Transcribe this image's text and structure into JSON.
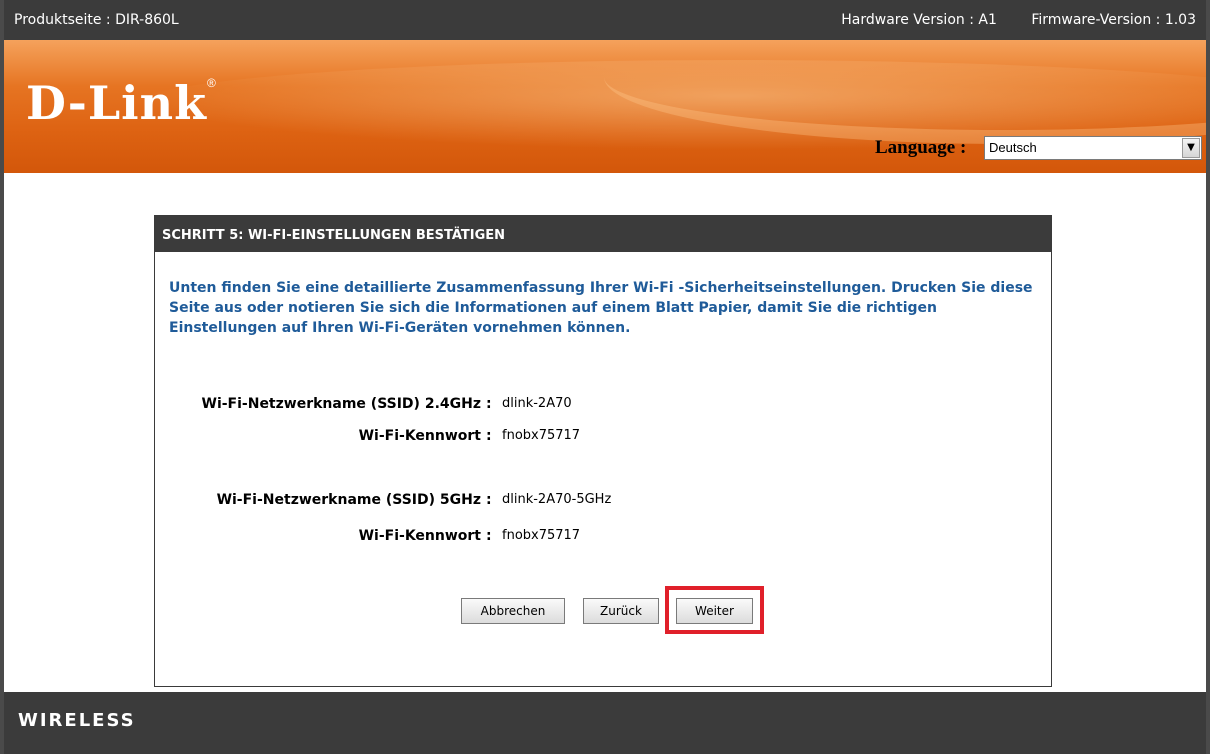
{
  "topbar": {
    "product": "Produktseite : DIR-860L",
    "hardware": "Hardware Version : A1",
    "firmware": "Firmware-Version : 1.03"
  },
  "header": {
    "logo": "D-Link",
    "logo_mark": "®",
    "language_label": "Language :",
    "language_value": "Deutsch"
  },
  "panel": {
    "title": "SCHRITT 5: WI-FI-EINSTELLUNGEN BESTÄTIGEN",
    "intro": "Unten finden Sie eine detaillierte Zusammenfassung Ihrer Wi-Fi -Sicherheitseinstellungen. Drucken Sie diese Seite aus oder notieren Sie sich die Informationen auf einem Blatt Papier, damit Sie die richtigen Einstellungen auf Ihren Wi-Fi-Geräten vornehmen können.",
    "rows": [
      {
        "label": "Wi-Fi-Netzwerkname (SSID) 2.4GHz",
        "colon": ":",
        "value": "dlink-2A70"
      },
      {
        "label": "Wi-Fi-Kennwort",
        "colon": ":",
        "value": "fnobx75717"
      },
      {
        "label": "Wi-Fi-Netzwerkname (SSID) 5GHz",
        "colon": ":",
        "value": "dlink-2A70-5GHz"
      },
      {
        "label": "Wi-Fi-Kennwort",
        "colon": ":",
        "value": "fnobx75717"
      }
    ],
    "buttons": {
      "cancel": "Abbrechen",
      "back": "Zurück",
      "next": "Weiter"
    },
    "highlight_color": "#e0202a"
  },
  "footer": {
    "text": "WIRELESS"
  },
  "colors": {
    "header_orange": "#e67422",
    "dark_bar": "#3b3b3b",
    "intro_blue": "#1f5b99"
  }
}
